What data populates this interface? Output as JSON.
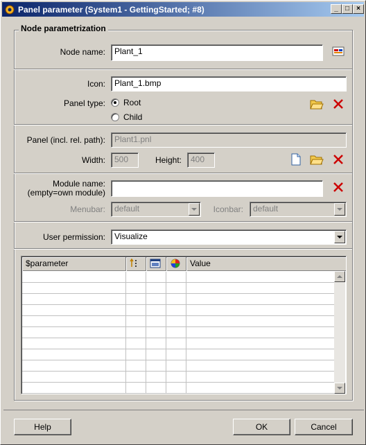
{
  "window": {
    "title": "Panel parameter (System1 - GettingStarted; #8)"
  },
  "group": {
    "title": "Node parametrization"
  },
  "node_name": {
    "label": "Node name:",
    "value": "Plant_1"
  },
  "icon": {
    "label": "Icon:",
    "value": "Plant_1.bmp"
  },
  "panel_type": {
    "label": "Panel type:",
    "options": [
      "Root",
      "Child"
    ],
    "selected": "Root"
  },
  "panel": {
    "label": "Panel (incl. rel. path):",
    "value": "Plant1.pnl"
  },
  "size": {
    "width_label": "Width:",
    "width": "500",
    "height_label": "Height:",
    "height": "400"
  },
  "module": {
    "label_line1": "Module name:",
    "label_line2": "(empty=own module)",
    "value": ""
  },
  "menubar": {
    "label": "Menubar:",
    "value": "default"
  },
  "iconbar": {
    "label": "Iconbar:",
    "value": "default"
  },
  "permission": {
    "label": "User permission:",
    "value": "Visualize"
  },
  "table": {
    "columns": [
      "$parameter",
      "",
      "",
      "",
      "Value"
    ],
    "rows": 11
  },
  "buttons": {
    "help": "Help",
    "ok": "OK",
    "cancel": "Cancel"
  },
  "colors": {
    "title_start": "#0a246a",
    "title_end": "#a6caf0",
    "delete_red": "#cc0000",
    "folder_yellow": "#f2c94c"
  }
}
